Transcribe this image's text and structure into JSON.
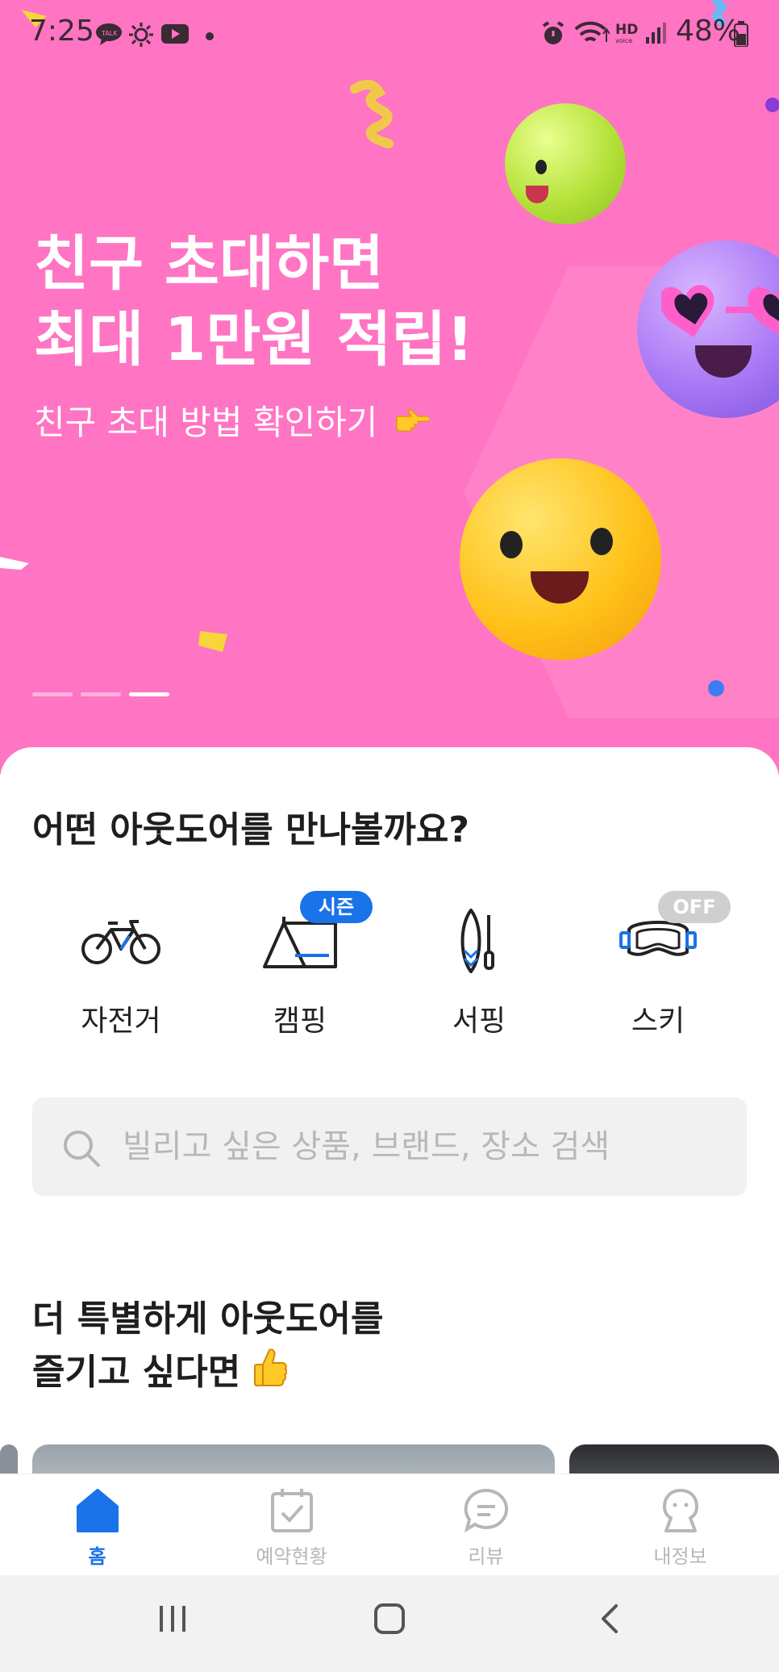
{
  "status_bar": {
    "time": "7:25",
    "battery": "48%",
    "icons": [
      "kakaotalk-icon",
      "sun-icon",
      "youtube-icon",
      "dot-icon",
      "alarm-icon",
      "wifi-icon",
      "hd-voice-icon",
      "signal-icon",
      "battery-icon"
    ]
  },
  "banner": {
    "title_line1": "친구 초대하면",
    "title_line2": "최대 1만원 적립!",
    "subtitle": "친구 초대 방법 확인하기",
    "background": "#ff74c3",
    "carousel": {
      "count": 3,
      "active_index": 2
    }
  },
  "categories_section": {
    "title": "어떤 아웃도어를 만나볼까요?",
    "items": [
      {
        "label": "자전거",
        "icon": "bicycle-icon"
      },
      {
        "label": "캠핑",
        "icon": "tent-icon",
        "badge": "시즌",
        "badge_color": "#1a73e8"
      },
      {
        "label": "서핑",
        "icon": "surfboard-icon"
      },
      {
        "label": "스키",
        "icon": "ski-goggles-icon",
        "badge": "OFF",
        "badge_color": "#cfcfcf"
      }
    ]
  },
  "search": {
    "placeholder": "빌리고 싶은 상품, 브랜드, 장소 검색",
    "value": ""
  },
  "special_section": {
    "title_line1": "더 특별하게 아웃도어를",
    "title_line2": "즐기고 싶다면"
  },
  "tab_bar": {
    "tabs": [
      {
        "label": "홈",
        "icon": "home-icon",
        "active": true
      },
      {
        "label": "예약현황",
        "icon": "calendar-check-icon",
        "active": false
      },
      {
        "label": "리뷰",
        "icon": "chat-bubble-icon",
        "active": false
      },
      {
        "label": "내정보",
        "icon": "person-icon",
        "active": false
      }
    ],
    "accent": "#1a73e8"
  },
  "nav_bar": {
    "buttons": [
      "recent-apps",
      "home",
      "back"
    ]
  }
}
